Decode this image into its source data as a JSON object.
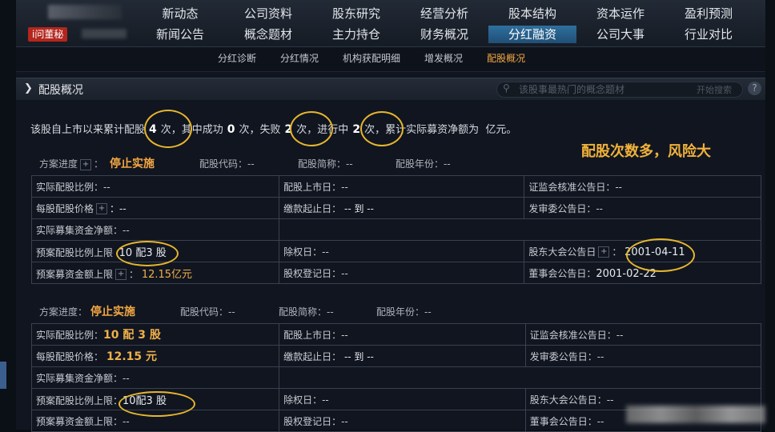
{
  "nav": {
    "row1": [
      "新动态",
      "公司资料",
      "股东研究",
      "经营分析",
      "股本结构",
      "资本运作",
      "盈利预测"
    ],
    "row2": [
      "新闻公告",
      "概念题材",
      "主力持仓",
      "财务概况",
      "分红融资",
      "公司大事",
      "行业对比"
    ],
    "active": "分红融资",
    "logo": "i问董秘"
  },
  "subnav": {
    "items": [
      "分红诊断",
      "分红情况",
      "机构获配明细",
      "增发概况",
      "配股概况"
    ],
    "active": "配股概况"
  },
  "section": {
    "title": "配股概况",
    "search_placeholder": "该股事最热门的概念题材",
    "search_button": "开始搜索",
    "help": "?"
  },
  "summary": {
    "t1": "该股自上市以来累计配股",
    "total": "4",
    "t2": "次，其中成功",
    "success": "0",
    "t3": "次，失败",
    "failed": "2",
    "t4": "次，进行中",
    "ongoing": "2",
    "t5": "次，累计实际募资净额为",
    "t6": "亿元。"
  },
  "annotation": "配股次数多，风险大",
  "schemes": [
    {
      "progress_label": "方案进度",
      "status": "停止实施",
      "code_label": "配股代码：",
      "code": "--",
      "abbr_label": "配股简称：",
      "abbr": "--",
      "year_label": "配股年份：",
      "year": "--",
      "rows": [
        [
          "实际配股比例：--",
          "配股上市日：--",
          "证监会核准公告日：--"
        ],
        [
          "每股配股价格",
          "缴款起止日：",
          "发审委公告日：--"
        ],
        [
          "实际募集资金净额：--",
          "",
          ""
        ],
        [
          "预案配股比例上限",
          "除权日：--",
          "股东大会公告日"
        ],
        [
          "预案募资金额上限",
          "股权登记日：--",
          "董事会公告日："
        ]
      ],
      "ratio_cap": "10 配3 股",
      "fund_cap": "12.15亿元",
      "price": "：--",
      "pay_dates": "-- 到 --",
      "agm_date": "2001-04-11",
      "board_date": "2001-02-22"
    },
    {
      "progress_label": "方案进度：",
      "status": "停止实施",
      "code_label": "配股代码：",
      "code": "--",
      "abbr_label": "配股简称：",
      "abbr": "--",
      "year_label": "配股年份：",
      "year": "--",
      "rows": [
        [
          "实际配股比例：",
          "配股上市日：--",
          "证监会核准公告日：--"
        ],
        [
          "每股配股价格：",
          "缴款起止日：",
          "发审委公告日：--"
        ],
        [
          "实际募集资金净额：--",
          "",
          ""
        ],
        [
          "预案配股比例上限：",
          "除权日：--",
          "股东大会公告日：--"
        ],
        [
          "预案募资金额上限：--",
          "股权登记日：--",
          "董事会公告日：--"
        ]
      ],
      "actual_ratio": "10 配 3 股",
      "price": "12.15 元",
      "pay_dates": "-- 到 --",
      "ratio_cap": "10配3 股"
    }
  ]
}
